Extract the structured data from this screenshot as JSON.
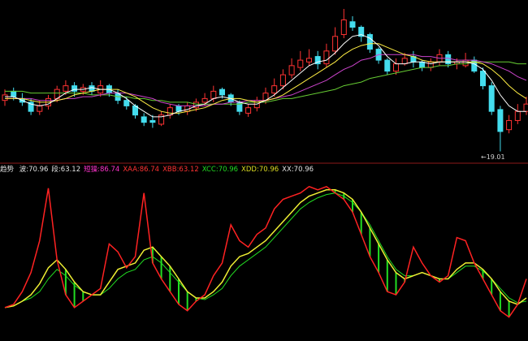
{
  "indicator": {
    "label": "趋势",
    "values": [
      {
        "name": "波",
        "value": "70.96",
        "color": "#e0e0e0"
      },
      {
        "name": "段",
        "value": "63.12",
        "color": "#e0e0e0"
      },
      {
        "name": "短操",
        "value": "86.74",
        "color": "#ff33cc"
      },
      {
        "name": "XAA",
        "value": "86.74",
        "color": "#ff3333"
      },
      {
        "name": "XBB",
        "value": "63.12",
        "color": "#ff3333"
      },
      {
        "name": "XCC",
        "value": "70.96",
        "color": "#22dd22"
      },
      {
        "name": "XDD",
        "value": "70.96",
        "color": "#dddd22"
      },
      {
        "name": "XX",
        "value": "70.96",
        "color": "#e0e0e0"
      }
    ]
  },
  "price_low_label": "19.01",
  "colors": {
    "background": "#000000",
    "up_candle": "#ff3333",
    "down_candle": "#44ddee",
    "ma_short": "#ffffff",
    "ma_mid": "#ffee44",
    "ma_long": "#cc44cc",
    "ma_longest": "#66cc33",
    "divider": "#8b1a1a",
    "osc_red": "#ff2222",
    "osc_yellow": "#eeee33",
    "osc_fill": "#22dd22"
  },
  "chart_data": [
    {
      "type": "candlestick",
      "close": [
        22.1,
        22.0,
        21.7,
        21.2,
        21.5,
        21.9,
        22.4,
        22.6,
        22.3,
        22.5,
        22.3,
        22.6,
        22.2,
        21.8,
        21.5,
        21.0,
        20.6,
        20.6,
        21.0,
        21.4,
        21.2,
        21.5,
        21.7,
        21.9,
        22.3,
        22.1,
        21.7,
        21.2,
        21.4,
        21.8,
        22.2,
        22.6,
        23.2,
        23.7,
        24.0,
        24.1,
        23.8,
        24.5,
        25.3,
        26.2,
        25.8,
        25.3,
        24.6,
        24.0,
        23.4,
        23.8,
        24.1,
        23.9,
        23.6,
        23.9,
        24.3,
        23.8,
        23.9,
        24.0,
        23.4,
        22.6,
        21.2,
        20.1,
        20.7,
        21.2,
        21.6
      ],
      "open": [
        21.8,
        22.3,
        21.9,
        21.7,
        21.2,
        21.5,
        21.9,
        22.3,
        22.6,
        22.3,
        22.6,
        22.2,
        22.6,
        22.2,
        21.8,
        21.5,
        20.9,
        20.7,
        20.5,
        21.0,
        21.5,
        21.2,
        21.4,
        21.7,
        21.9,
        22.4,
        22.1,
        21.7,
        21.1,
        21.4,
        21.8,
        22.2,
        22.6,
        23.2,
        23.6,
        23.9,
        24.2,
        23.8,
        24.5,
        25.4,
        26.1,
        25.8,
        25.4,
        24.6,
        24.0,
        23.4,
        23.8,
        24.2,
        23.9,
        23.6,
        23.9,
        24.3,
        23.8,
        23.7,
        24.0,
        23.4,
        22.6,
        21.3,
        20.2,
        20.7,
        21.2
      ],
      "high": [
        22.4,
        22.5,
        22.2,
        21.9,
        21.8,
        22.1,
        22.6,
        22.9,
        22.8,
        22.7,
        22.8,
        22.9,
        22.7,
        22.4,
        22.0,
        21.6,
        21.1,
        21.0,
        21.2,
        21.6,
        21.6,
        21.7,
        21.9,
        22.2,
        22.6,
        22.5,
        22.2,
        21.8,
        21.6,
        22.0,
        22.5,
        23.0,
        23.5,
        24.1,
        24.5,
        24.6,
        24.5,
        24.9,
        25.8,
        26.8,
        26.4,
        25.9,
        25.5,
        24.7,
        24.1,
        24.1,
        24.4,
        24.5,
        24.0,
        24.1,
        24.6,
        24.5,
        24.1,
        24.4,
        24.2,
        23.6,
        22.8,
        21.5,
        21.0,
        21.6,
        22.0
      ],
      "low": [
        21.5,
        21.8,
        21.5,
        21.0,
        21.0,
        21.3,
        21.7,
        22.1,
        22.0,
        22.1,
        22.1,
        22.0,
        22.0,
        21.6,
        21.3,
        20.8,
        20.4,
        20.3,
        20.4,
        20.8,
        21.0,
        21.0,
        21.2,
        21.5,
        21.7,
        21.9,
        21.5,
        21.0,
        20.9,
        21.2,
        21.6,
        22.0,
        22.4,
        23.0,
        23.4,
        23.7,
        23.5,
        23.6,
        24.3,
        25.2,
        25.6,
        25.0,
        24.4,
        23.8,
        23.2,
        23.2,
        23.7,
        23.6,
        23.4,
        23.4,
        23.7,
        23.6,
        23.5,
        23.6,
        23.3,
        22.4,
        21.0,
        19.01,
        20.0,
        20.5,
        21.0
      ],
      "ma_short": [
        22.0,
        22.0,
        21.8,
        21.6,
        21.5,
        21.6,
        21.9,
        22.2,
        22.4,
        22.4,
        22.5,
        22.4,
        22.4,
        22.2,
        21.9,
        21.5,
        21.2,
        20.9,
        20.9,
        21.0,
        21.2,
        21.3,
        21.5,
        21.6,
        21.9,
        22.0,
        21.9,
        21.7,
        21.6,
        21.6,
        21.8,
        22.1,
        22.5,
        22.9,
        23.3,
        23.7,
        23.9,
        24.0,
        24.4,
        24.9,
        25.3,
        25.4,
        25.2,
        24.8,
        24.2,
        23.8,
        23.8,
        23.9,
        23.9,
        23.8,
        23.9,
        23.9,
        23.9,
        23.9,
        23.8,
        23.5,
        22.9,
        22.1,
        21.5,
        21.2,
        21.2
      ],
      "ma_mid": [
        21.9,
        21.9,
        21.9,
        21.8,
        21.7,
        21.7,
        21.8,
        21.9,
        22.1,
        22.2,
        22.3,
        22.4,
        22.4,
        22.4,
        22.2,
        22.0,
        21.7,
        21.4,
        21.2,
        21.1,
        21.1,
        21.2,
        21.3,
        21.4,
        21.6,
        21.8,
        21.9,
        21.9,
        21.8,
        21.7,
        21.8,
        21.9,
        22.1,
        22.4,
        22.7,
        23.0,
        23.3,
        23.6,
        23.9,
        24.3,
        24.6,
        24.8,
        24.9,
        24.9,
        24.7,
        24.5,
        24.3,
        24.2,
        24.0,
        23.9,
        23.9,
        23.9,
        23.9,
        23.9,
        23.9,
        23.8,
        23.5,
        23.1,
        22.6,
        22.2,
        21.9
      ],
      "ma_long": [
        21.9,
        21.9,
        21.9,
        21.9,
        21.8,
        21.8,
        21.8,
        21.9,
        21.9,
        22.0,
        22.0,
        22.1,
        22.2,
        22.2,
        22.2,
        22.1,
        22.0,
        21.9,
        21.7,
        21.6,
        21.5,
        21.5,
        21.5,
        21.5,
        21.6,
        21.6,
        21.7,
        21.7,
        21.8,
        21.8,
        21.8,
        21.9,
        22.0,
        22.1,
        22.3,
        22.5,
        22.7,
        22.9,
        23.2,
        23.5,
        23.7,
        24.0,
        24.1,
        24.3,
        24.3,
        24.3,
        24.3,
        24.3,
        24.2,
        24.2,
        24.1,
        24.1,
        24.0,
        24.0,
        24.0,
        23.9,
        23.8,
        23.6,
        23.4,
        23.1,
        22.9
      ],
      "ma_longest": [
        22.3,
        22.3,
        22.3,
        22.2,
        22.2,
        22.2,
        22.2,
        22.2,
        22.2,
        22.2,
        22.1,
        22.1,
        22.1,
        22.0,
        22.0,
        21.9,
        21.9,
        21.8,
        21.8,
        21.7,
        21.7,
        21.7,
        21.6,
        21.6,
        21.6,
        21.6,
        21.6,
        21.6,
        21.7,
        21.7,
        21.7,
        21.8,
        21.9,
        21.9,
        22.0,
        22.1,
        22.2,
        22.3,
        22.4,
        22.6,
        22.7,
        22.8,
        23.0,
        23.1,
        23.2,
        23.3,
        23.4,
        23.5,
        23.6,
        23.6,
        23.7,
        23.7,
        23.8,
        23.8,
        23.9,
        23.9,
        23.9,
        23.9,
        23.9,
        23.8,
        23.8
      ]
    },
    {
      "type": "line",
      "series": [
        {
          "values": [
            20,
            22,
            30,
            42,
            62,
            95,
            50,
            28,
            20,
            24,
            28,
            32,
            60,
            55,
            45,
            52,
            92,
            48,
            38,
            30,
            22,
            18,
            24,
            28,
            40,
            48,
            72,
            62,
            58,
            66,
            70,
            82,
            88,
            90,
            92,
            96,
            94,
            96,
            92,
            88,
            80,
            66,
            52,
            42,
            30,
            28,
            36,
            58,
            48,
            40,
            36,
            40,
            64,
            62,
            48,
            38,
            28,
            18,
            14,
            22,
            38
          ]
        },
        {
          "values": [
            20,
            21,
            24,
            28,
            35,
            45,
            50,
            44,
            36,
            30,
            28,
            28,
            36,
            44,
            46,
            48,
            56,
            58,
            52,
            46,
            38,
            30,
            26,
            26,
            30,
            36,
            46,
            52,
            54,
            58,
            62,
            68,
            74,
            80,
            86,
            90,
            92,
            94,
            94,
            92,
            88,
            80,
            70,
            60,
            50,
            42,
            38,
            40,
            42,
            40,
            38,
            38,
            44,
            48,
            48,
            44,
            38,
            30,
            24,
            22,
            26
          ]
        },
        {
          "values": [
            20,
            21,
            24,
            26,
            30,
            38,
            44,
            40,
            34,
            30,
            28,
            28,
            32,
            38,
            42,
            44,
            50,
            52,
            48,
            42,
            36,
            30,
            26,
            25,
            28,
            32,
            40,
            46,
            50,
            54,
            58,
            64,
            70,
            76,
            82,
            86,
            89,
            91,
            92,
            90,
            86,
            80,
            72,
            62,
            52,
            44,
            40,
            40,
            42,
            40,
            38,
            38,
            42,
            46,
            46,
            43,
            38,
            32,
            26,
            23,
            24
          ]
        }
      ]
    }
  ]
}
